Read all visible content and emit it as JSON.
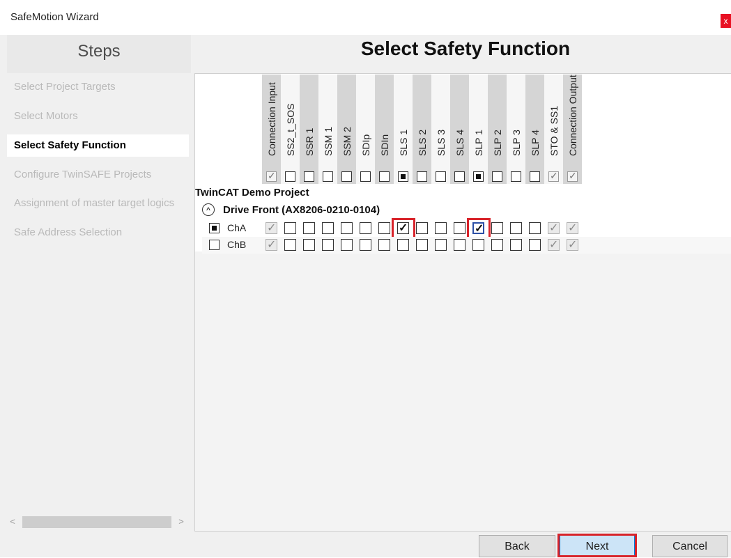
{
  "window": {
    "title": "SafeMotion Wizard",
    "close_glyph": "x"
  },
  "steps": {
    "heading": "Steps",
    "items": [
      {
        "label": "Select Project Targets",
        "state": "done"
      },
      {
        "label": "Select Motors",
        "state": "done"
      },
      {
        "label": "Select Safety Function",
        "state": "active"
      },
      {
        "label": "Configure TwinSAFE Projects",
        "state": "pending"
      },
      {
        "label": "Assignment of master target logics",
        "state": "pending"
      },
      {
        "label": "Safe Address Selection",
        "state": "pending"
      }
    ],
    "scroll_left_glyph": "<",
    "scroll_right_glyph": ">"
  },
  "main": {
    "title": "Select Safety Function",
    "columns": [
      {
        "label": "Connection Input",
        "header": "checked"
      },
      {
        "label": "SS2_t_SOS",
        "header": "empty"
      },
      {
        "label": "SSR 1",
        "header": "empty"
      },
      {
        "label": "SSM 1",
        "header": "empty"
      },
      {
        "label": "SSM 2",
        "header": "empty"
      },
      {
        "label": "SDIp",
        "header": "empty"
      },
      {
        "label": "SDIn",
        "header": "empty"
      },
      {
        "label": "SLS 1",
        "header": "partial"
      },
      {
        "label": "SLS 2",
        "header": "empty"
      },
      {
        "label": "SLS 3",
        "header": "empty"
      },
      {
        "label": "SLS 4",
        "header": "empty"
      },
      {
        "label": "SLP 1",
        "header": "partial"
      },
      {
        "label": "SLP 2",
        "header": "empty"
      },
      {
        "label": "SLP 3",
        "header": "empty"
      },
      {
        "label": "SLP 4",
        "header": "empty"
      },
      {
        "label": "STO & SS1",
        "header": "checked"
      },
      {
        "label": "Connection Output",
        "header": "checked"
      }
    ],
    "project": "TwinCAT Demo Project",
    "drive": {
      "label": "Drive Front (AX8206-0210-0104)",
      "toggle_glyph": "^"
    },
    "channels": [
      {
        "label": "ChA",
        "selected": "partial",
        "values": [
          true,
          false,
          false,
          false,
          false,
          false,
          false,
          true,
          false,
          false,
          false,
          true,
          false,
          false,
          false,
          true,
          true
        ]
      },
      {
        "label": "ChB",
        "selected": "empty",
        "values": [
          true,
          false,
          false,
          false,
          false,
          false,
          false,
          false,
          false,
          false,
          false,
          false,
          false,
          false,
          false,
          true,
          true
        ]
      }
    ]
  },
  "buttons": {
    "back": "Back",
    "next": "Next",
    "cancel": "Cancel"
  },
  "colors": {
    "highlight": "#d8232a",
    "next_button": "#cce4f7",
    "column_shade": "#d5d5d5"
  }
}
